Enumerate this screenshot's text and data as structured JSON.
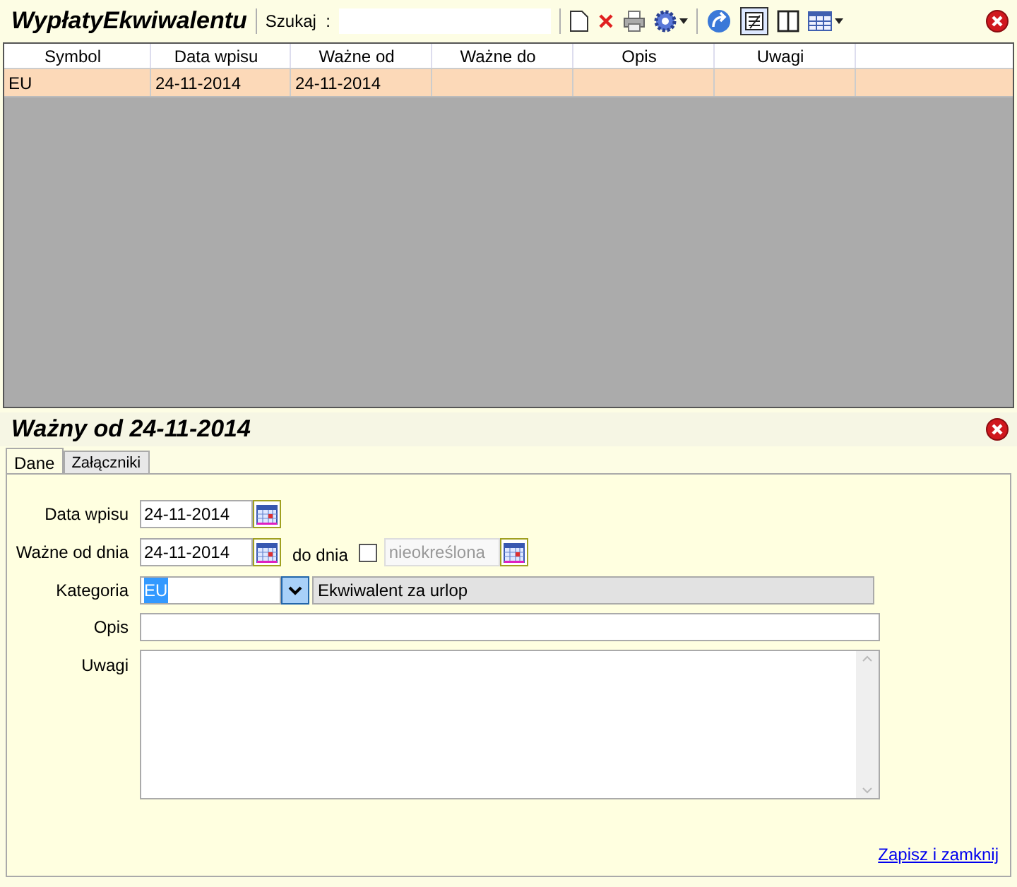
{
  "list_panel": {
    "title": "WypłatyEkwiwalentu",
    "search": {
      "label": "Szukaj  :"
    }
  },
  "table": {
    "columns": [
      "Symbol",
      "Data wpisu",
      "Ważne od",
      "Ważne do",
      "Opis",
      "Uwagi"
    ],
    "rows": [
      {
        "cells": [
          "EU",
          "24-11-2014",
          "24-11-2014",
          "",
          "",
          ""
        ],
        "selected": true
      }
    ]
  },
  "detail_panel": {
    "title": "Ważny od 24-11-2014",
    "tabs": [
      {
        "label": "Dane",
        "selected": true
      },
      {
        "label": "Załączniki",
        "selected": false
      }
    ],
    "form": {
      "data_wpisu": {
        "label": "Data wpisu",
        "value": "24-11-2014"
      },
      "wazne_od": {
        "label": "Ważne od dnia",
        "value": "24-11-2014"
      },
      "do_dnia": {
        "label": "do dnia",
        "checked": false,
        "placeholder": "nieokreślona",
        "disabled": true
      },
      "kategoria": {
        "label": "Kategoria",
        "value": "EU",
        "description": "Ekwiwalent za urlop"
      },
      "opis": {
        "label": "Opis"
      },
      "uwagi": {
        "label": "Uwagi"
      }
    },
    "link": "Zapisz i zamknij"
  }
}
